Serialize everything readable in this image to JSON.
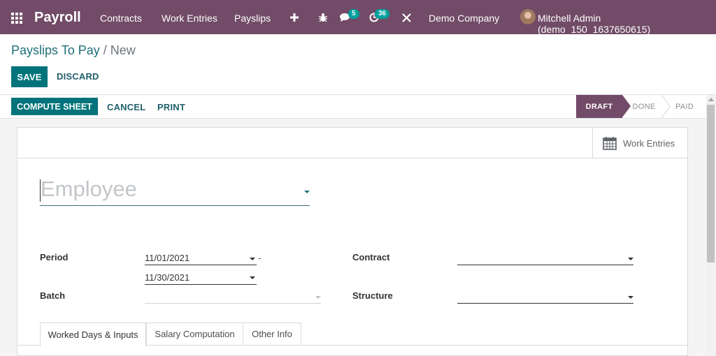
{
  "navbar": {
    "app_name": "Payroll",
    "menu": [
      "Contracts",
      "Work Entries",
      "Payslips"
    ],
    "messages_count": "5",
    "activities_count": "36",
    "company": "Demo Company",
    "user": "Mitchell Admin (demo_150_1637650615)"
  },
  "breadcrumb": {
    "parent": "Payslips To Pay",
    "separator": "/",
    "current": "New"
  },
  "control": {
    "save": "SAVE",
    "discard": "DISCARD"
  },
  "header_buttons": {
    "compute": "COMPUTE SHEET",
    "cancel": "CANCEL",
    "print": "PRINT"
  },
  "statusbar": {
    "stages": [
      "DRAFT",
      "DONE",
      "PAID"
    ],
    "active": "DRAFT"
  },
  "smart_button": {
    "label": "Work Entries",
    "icon": "calendar-icon"
  },
  "form": {
    "employee_placeholder": "Employee",
    "period_label": "Period",
    "date_from": "11/01/2021",
    "date_separator": "-",
    "date_to": "11/30/2021",
    "batch_label": "Batch",
    "batch_value": "",
    "contract_label": "Contract",
    "contract_value": "",
    "structure_label": "Structure",
    "structure_value": ""
  },
  "tabs": [
    "Worked Days & Inputs",
    "Salary Computation",
    "Other Info"
  ],
  "colors": {
    "navbar": "#714b67",
    "primary": "#00737b",
    "link": "#1f5f6a"
  }
}
